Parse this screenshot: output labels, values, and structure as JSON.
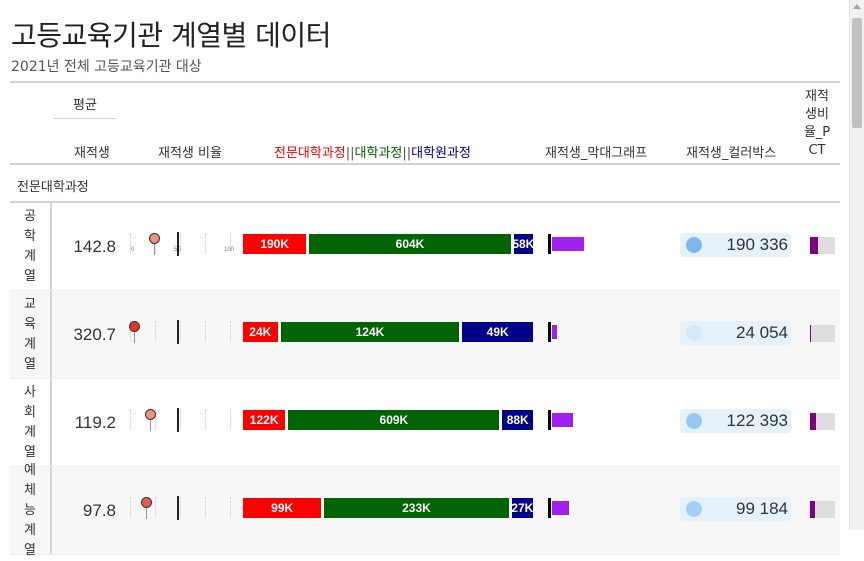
{
  "title": "고등교육기관 계열별 데이터",
  "subtitle": "2021년 전체 고등교육기관 대상",
  "header": {
    "group": "평균",
    "col_avg": "재적생",
    "col_ratio": "재적생 비율",
    "col_stack": {
      "a": "전문대학과정",
      "sep1": "||",
      "b": "대학과정",
      "sep2": "||",
      "c": "대학원과정"
    },
    "col_bar": "재적생_막대그래프",
    "col_box": "재적생_컬러박스",
    "col_pct": "재적생비율_PCT"
  },
  "section": "전문대학과정",
  "colors": {
    "red": "#ff0000",
    "green": "#006400",
    "navy": "#00008b",
    "bar": "#a020f0",
    "pct": "#800080"
  },
  "bullet_axis": [
    "0",
    "50",
    "100"
  ],
  "rows": [
    {
      "label": "공학계열",
      "avg": "142.8",
      "ratio": 23,
      "stack": [
        {
          "v": 190,
          "t": "190K"
        },
        {
          "v": 604,
          "t": "604K"
        },
        {
          "v": 58,
          "t": "58K"
        }
      ],
      "bar": 0.36,
      "box": "190 336",
      "box_color": "#7bb8ef",
      "pct": 0.33,
      "show_axis": true
    },
    {
      "label": "교육계열",
      "avg": "320.7",
      "ratio": 3,
      "stack": [
        {
          "v": 24,
          "t": "24K"
        },
        {
          "v": 124,
          "t": "124K"
        },
        {
          "v": 49,
          "t": "49K"
        }
      ],
      "bar": 0.05,
      "box": "24 054",
      "box_color": "#d6e8fa",
      "pct": 0.05,
      "show_axis": false
    },
    {
      "label": "사회계열",
      "avg": "119.2",
      "ratio": 19,
      "stack": [
        {
          "v": 122,
          "t": "122K"
        },
        {
          "v": 609,
          "t": "609K"
        },
        {
          "v": 88,
          "t": "88K"
        }
      ],
      "bar": 0.23,
      "box": "122 393",
      "box_color": "#97c8f3",
      "pct": 0.24,
      "show_axis": false
    },
    {
      "label": "예체능계열",
      "avg": "97.8",
      "ratio": 15,
      "stack": [
        {
          "v": 99,
          "t": "99K"
        },
        {
          "v": 233,
          "t": "233K"
        },
        {
          "v": 27,
          "t": "27K"
        }
      ],
      "bar": 0.19,
      "box": "99 184",
      "box_color": "#a5d0f5",
      "pct": 0.2,
      "show_axis": false
    }
  ]
}
